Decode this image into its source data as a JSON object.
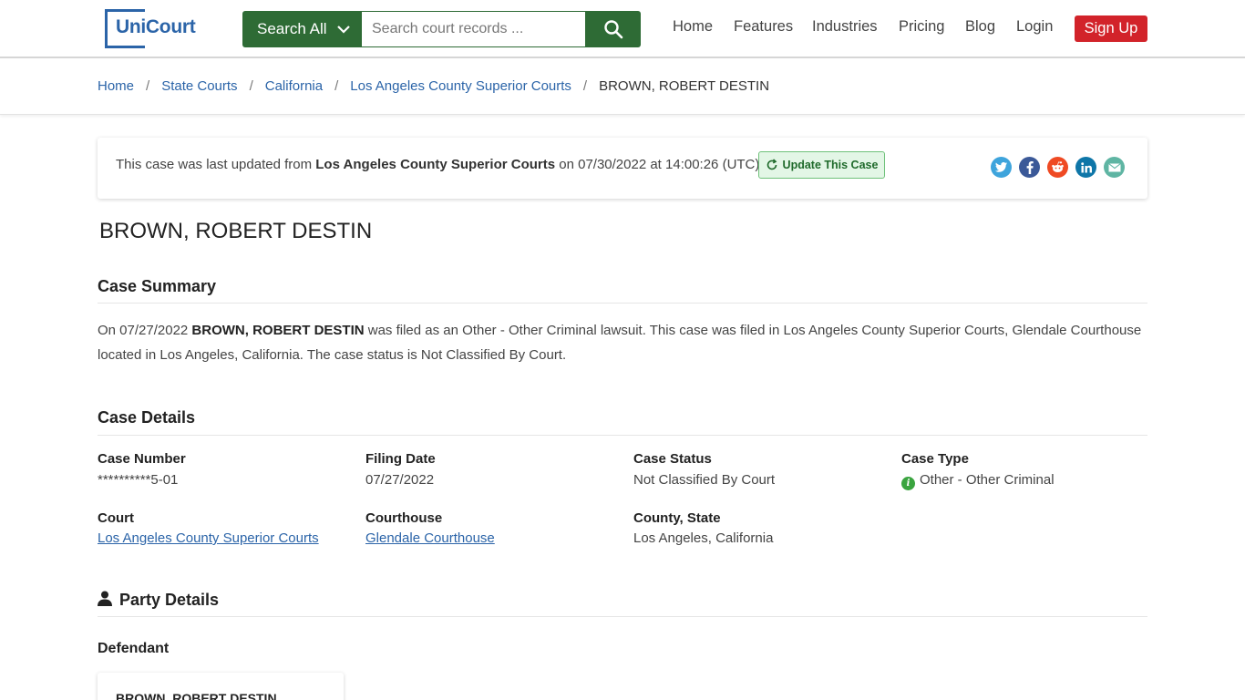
{
  "brand": {
    "logo_text": "UniCourt",
    "accent": "#2b64a8",
    "green": "#2e6b35",
    "red": "#d2232a"
  },
  "search": {
    "scope_label": "Search All",
    "placeholder": "Search court records ..."
  },
  "nav": {
    "home": "Home",
    "features": "Features",
    "industries": "Industries",
    "pricing": "Pricing",
    "blog": "Blog",
    "login": "Login",
    "signup": "Sign Up"
  },
  "breadcrumb": [
    "Home",
    "State Courts",
    "California",
    "Los Angeles County Superior Courts",
    "BROWN, ROBERT DESTIN"
  ],
  "update": {
    "prefix": "This case was last updated from ",
    "court": "Los Angeles County Superior Courts",
    "suffix": " on 07/30/2022 at 14:00:26 (UTC).",
    "button": "Update This Case",
    "share_icons": [
      "twitter-icon",
      "facebook-icon",
      "reddit-icon",
      "linkedin-icon",
      "email-icon"
    ]
  },
  "case_title": "BROWN, ROBERT DESTIN",
  "summary": {
    "heading": "Case Summary",
    "pre": "On 07/27/2022 ",
    "party": "BROWN, ROBERT DESTIN",
    "post": " was filed as an Other - Other Criminal lawsuit. This case was filed in Los Angeles County Superior Courts, Glendale Courthouse located in Los Angeles, California. The case status is Not Classified By Court."
  },
  "details": {
    "heading": "Case Details",
    "case_number_label": "Case Number",
    "case_number": "**********5-01",
    "filing_date_label": "Filing Date",
    "filing_date": "07/27/2022",
    "status_label": "Case Status",
    "status": "Not Classified By Court",
    "type_label": "Case Type",
    "type": "Other - Other Criminal",
    "court_label": "Court",
    "court": "Los Angeles County Superior Courts",
    "courthouse_label": "Courthouse",
    "courthouse": "Glendale Courthouse",
    "county_label": "County, State",
    "county": "Los Angeles, California"
  },
  "party": {
    "heading": "Party Details",
    "role": "Defendant",
    "name": "BROWN, ROBERT DESTIN"
  }
}
